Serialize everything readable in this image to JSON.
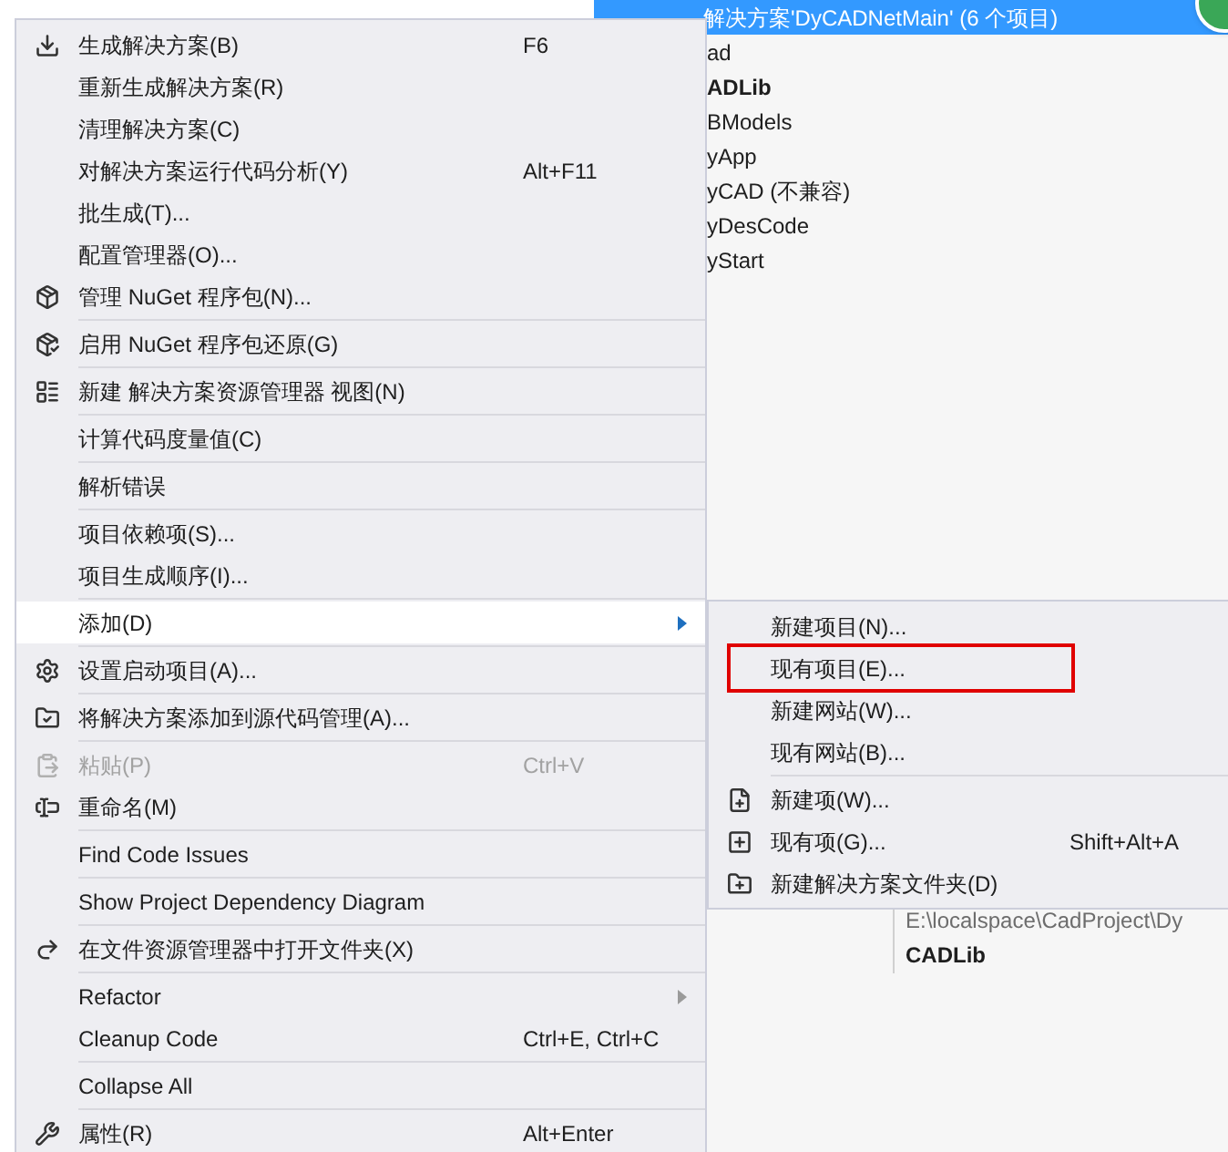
{
  "solution_explorer": {
    "header": {
      "label": "解决方案'DyCADNetMain' (6 个项目)",
      "selected": true
    },
    "items": [
      {
        "label": "ad",
        "bold": false
      },
      {
        "label": "ADLib",
        "bold": true
      },
      {
        "label": "BModels",
        "bold": false
      },
      {
        "label": "yApp",
        "bold": false
      },
      {
        "label": "yCAD (不兼容)",
        "bold": false
      },
      {
        "label": "yDesCode",
        "bold": false
      },
      {
        "label": "yStart",
        "bold": false
      }
    ]
  },
  "properties": [
    {
      "value": "E:\\localspace\\CadProject\\Dy",
      "bold": false
    },
    {
      "value": "CADLib",
      "bold": true
    }
  ],
  "context_menu": {
    "groups": [
      [
        {
          "label": "生成解决方案(B)",
          "shortcut": "F6",
          "disabled": false,
          "selected": false,
          "submenu": false
        },
        {
          "label": "重新生成解决方案(R)",
          "disabled": false,
          "selected": false,
          "submenu": false
        },
        {
          "label": "清理解决方案(C)",
          "disabled": false,
          "selected": false,
          "submenu": false
        },
        {
          "label": "对解决方案运行代码分析(Y)",
          "shortcut": "Alt+F11",
          "disabled": false,
          "selected": false,
          "submenu": false
        },
        {
          "label": "批生成(T)...",
          "disabled": false,
          "selected": false,
          "submenu": false
        },
        {
          "label": "配置管理器(O)...",
          "disabled": false,
          "selected": false,
          "submenu": false
        },
        {
          "label": "管理 NuGet 程序包(N)...",
          "disabled": false,
          "selected": false,
          "submenu": false
        }
      ],
      [
        {
          "label": "启用 NuGet 程序包还原(G)",
          "disabled": false,
          "selected": false,
          "submenu": false
        }
      ],
      [
        {
          "label": "新建 解决方案资源管理器 视图(N)",
          "disabled": false,
          "selected": false,
          "submenu": false
        }
      ],
      [
        {
          "label": "计算代码度量值(C)",
          "disabled": false,
          "selected": false,
          "submenu": false
        }
      ],
      [
        {
          "label": "解析错误",
          "disabled": false,
          "selected": false,
          "submenu": false
        }
      ],
      [
        {
          "label": "项目依赖项(S)...",
          "disabled": false,
          "selected": false,
          "submenu": false
        },
        {
          "label": "项目生成顺序(I)...",
          "disabled": false,
          "selected": false,
          "submenu": false
        }
      ],
      [
        {
          "label": "添加(D)",
          "disabled": false,
          "selected": true,
          "submenu": true
        }
      ],
      [
        {
          "label": "设置启动项目(A)...",
          "disabled": false,
          "selected": false,
          "submenu": false
        }
      ],
      [
        {
          "label": "将解决方案添加到源代码管理(A)...",
          "disabled": false,
          "selected": false,
          "submenu": false
        }
      ],
      [
        {
          "label": "粘贴(P)",
          "shortcut": "Ctrl+V",
          "disabled": true,
          "selected": false,
          "submenu": false
        },
        {
          "label": "重命名(M)",
          "disabled": false,
          "selected": false,
          "submenu": false
        }
      ],
      [
        {
          "label": "Find Code Issues",
          "disabled": false,
          "selected": false,
          "submenu": false
        }
      ],
      [
        {
          "label": "Show Project Dependency Diagram",
          "disabled": false,
          "selected": false,
          "submenu": false
        }
      ],
      [
        {
          "label": "在文件资源管理器中打开文件夹(X)",
          "disabled": false,
          "selected": false,
          "submenu": false
        }
      ],
      [
        {
          "label": "Refactor",
          "disabled": false,
          "selected": false,
          "submenu": true
        },
        {
          "label": "Cleanup Code",
          "shortcut": "Ctrl+E, Ctrl+C",
          "disabled": false,
          "selected": false,
          "submenu": false
        }
      ],
      [
        {
          "label": "Collapse All",
          "disabled": false,
          "selected": false,
          "submenu": false
        }
      ],
      [
        {
          "label": "属性(R)",
          "shortcut": "Alt+Enter",
          "disabled": false,
          "selected": false,
          "submenu": false
        }
      ]
    ]
  },
  "submenu": {
    "groups": [
      [
        {
          "label": "新建项目(N)...",
          "annotated": false
        },
        {
          "label": "现有项目(E)...",
          "annotated": true
        },
        {
          "label": "新建网站(W)...",
          "annotated": false
        },
        {
          "label": "现有网站(B)...",
          "annotated": false
        }
      ],
      [
        {
          "label": "新建项(W)...",
          "annotated": false
        },
        {
          "label": "现有项(G)...",
          "shortcut": "Shift+Alt+A",
          "annotated": false
        },
        {
          "label": "新建解决方案文件夹(D)",
          "annotated": false
        }
      ]
    ]
  }
}
